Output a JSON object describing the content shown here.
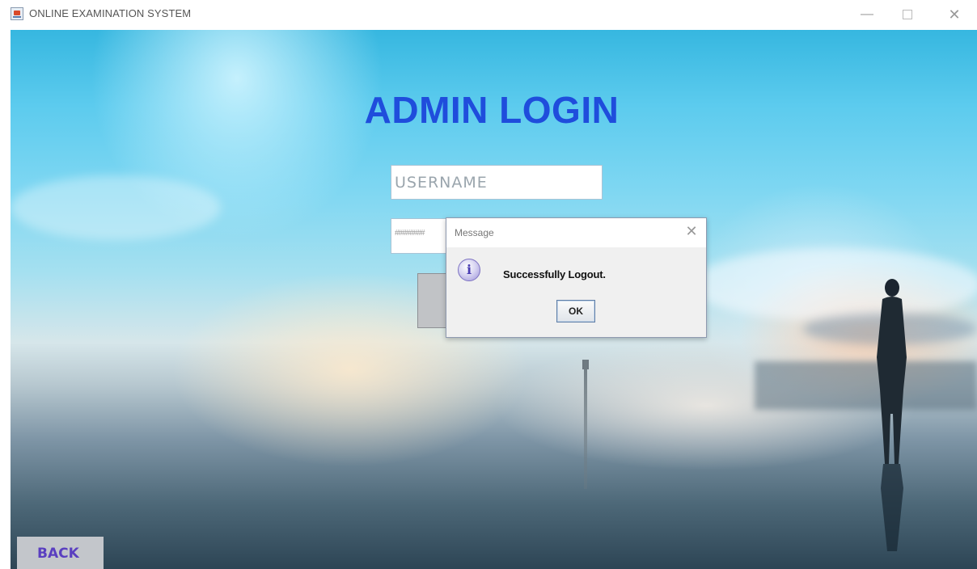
{
  "window": {
    "title": "ONLINE EXAMINATION SYSTEM",
    "minimize_glyph": "—",
    "close_glyph": "✕"
  },
  "form": {
    "heading": "ADMIN LOGIN",
    "username_placeholder": "USERNAME",
    "password_mask": "########",
    "back_label": "BACK"
  },
  "dialog": {
    "title": "Message",
    "close_glyph": "✕",
    "icon": "info-icon",
    "icon_glyph": "i",
    "message": "Successfully Logout.",
    "ok_label": "OK"
  },
  "colors": {
    "heading": "#1f4ddc",
    "back_label": "#5a3fc0",
    "sky_top": "#36b7e0"
  }
}
